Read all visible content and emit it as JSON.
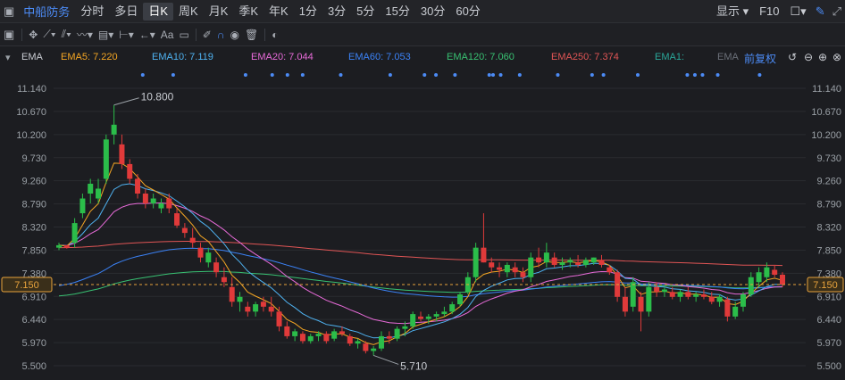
{
  "top": {
    "stock_name": "中船防务",
    "periods": [
      "分时",
      "多日",
      "日K",
      "周K",
      "月K",
      "季K",
      "年K",
      "1分",
      "3分",
      "5分",
      "15分",
      "30分",
      "60分"
    ],
    "active_period": "日K",
    "display_label": "显示",
    "f10_label": "F10"
  },
  "tools": {
    "text_tool_label": "Aa"
  },
  "indicators": {
    "main_label": "EMA",
    "ema5": "EMA5: 7.220",
    "ema10": "EMA10: 7.119",
    "ema20": "EMA20: 7.044",
    "ema60": "EMA60: 7.053",
    "ema120": "EMA120: 7.060",
    "ema250": "EMA250: 7.374",
    "ema1": "EMA1:",
    "ema_extra": "EMA",
    "adjust_label": "前复权"
  },
  "colors": {
    "up": "#2bbd4a",
    "down": "#e03a3a",
    "ema5": "#f5a623",
    "ema10": "#4fb3f2",
    "ema20": "#e86bd9",
    "ema60": "#3b82f6",
    "ema120": "#38c172",
    "ema250": "#e05555",
    "current_price": "#e8a33c"
  },
  "chart_data": {
    "type": "candlestick",
    "y_ticks": [
      "11.140",
      "10.670",
      "10.200",
      "9.730",
      "9.260",
      "8.790",
      "8.320",
      "7.850",
      "7.380",
      "6.910",
      "6.440",
      "5.970",
      "5.500"
    ],
    "ylim": [
      5.5,
      11.14
    ],
    "current_price": "7.150",
    "high_marker": "10.800",
    "low_marker": "5.710",
    "candles": [
      [
        7.9,
        8.0,
        7.85,
        7.95
      ],
      [
        7.95,
        7.95,
        7.88,
        7.9
      ],
      [
        8.0,
        8.5,
        7.9,
        8.4
      ],
      [
        8.6,
        9.0,
        8.5,
        8.9
      ],
      [
        9.0,
        9.3,
        8.8,
        9.2
      ],
      [
        8.9,
        9.3,
        8.8,
        9.1
      ],
      [
        9.3,
        10.2,
        9.2,
        10.1
      ],
      [
        10.2,
        10.8,
        10.0,
        10.4
      ],
      [
        10.0,
        10.2,
        9.5,
        9.6
      ],
      [
        9.6,
        9.7,
        9.2,
        9.3
      ],
      [
        9.3,
        9.4,
        8.9,
        9.0
      ],
      [
        9.0,
        9.1,
        8.7,
        8.8
      ],
      [
        8.8,
        9.0,
        8.7,
        8.9
      ],
      [
        8.7,
        8.9,
        8.6,
        8.8
      ],
      [
        8.9,
        9.0,
        8.6,
        8.7
      ],
      [
        8.6,
        8.7,
        8.3,
        8.35
      ],
      [
        8.3,
        8.4,
        8.1,
        8.2
      ],
      [
        8.1,
        8.3,
        7.9,
        8.0
      ],
      [
        7.9,
        8.0,
        7.6,
        7.7
      ],
      [
        7.6,
        7.9,
        7.5,
        7.8
      ],
      [
        7.6,
        7.7,
        7.3,
        7.4
      ],
      [
        7.3,
        7.5,
        7.1,
        7.2
      ],
      [
        7.1,
        7.3,
        6.7,
        6.8
      ],
      [
        6.8,
        7.0,
        6.6,
        6.9
      ],
      [
        6.7,
        6.8,
        6.5,
        6.6
      ],
      [
        6.6,
        6.8,
        6.5,
        6.75
      ],
      [
        6.8,
        6.9,
        6.6,
        6.7
      ],
      [
        6.7,
        6.9,
        6.5,
        6.6
      ],
      [
        6.6,
        6.7,
        6.2,
        6.3
      ],
      [
        6.3,
        6.4,
        6.05,
        6.1
      ],
      [
        6.1,
        6.25,
        6.0,
        6.2
      ],
      [
        6.15,
        6.2,
        5.95,
        6.0
      ],
      [
        6.0,
        6.15,
        5.95,
        6.1
      ],
      [
        6.1,
        6.2,
        6.0,
        6.15
      ],
      [
        6.15,
        6.2,
        5.95,
        6.0
      ],
      [
        6.05,
        6.25,
        6.0,
        6.2
      ],
      [
        6.2,
        6.3,
        6.1,
        6.15
      ],
      [
        6.1,
        6.15,
        5.9,
        5.95
      ],
      [
        5.95,
        6.05,
        5.85,
        6.0
      ],
      [
        5.95,
        6.0,
        5.75,
        5.8
      ],
      [
        5.8,
        5.9,
        5.71,
        5.85
      ],
      [
        5.85,
        6.2,
        5.8,
        6.1
      ],
      [
        6.1,
        6.2,
        5.95,
        6.05
      ],
      [
        6.05,
        6.3,
        6.0,
        6.25
      ],
      [
        6.25,
        6.4,
        6.1,
        6.3
      ],
      [
        6.3,
        6.6,
        6.25,
        6.55
      ],
      [
        6.5,
        6.6,
        6.4,
        6.45
      ],
      [
        6.45,
        6.55,
        6.35,
        6.5
      ],
      [
        6.5,
        6.6,
        6.4,
        6.55
      ],
      [
        6.55,
        6.7,
        6.5,
        6.6
      ],
      [
        6.6,
        6.8,
        6.55,
        6.75
      ],
      [
        6.75,
        7.0,
        6.7,
        6.95
      ],
      [
        7.0,
        7.4,
        6.95,
        7.3
      ],
      [
        7.3,
        8.0,
        7.2,
        7.9
      ],
      [
        7.9,
        8.6,
        7.6,
        7.6
      ],
      [
        7.6,
        7.7,
        7.4,
        7.5
      ],
      [
        7.5,
        7.6,
        7.3,
        7.45
      ],
      [
        7.4,
        7.6,
        7.3,
        7.55
      ],
      [
        7.5,
        7.6,
        7.3,
        7.4
      ],
      [
        7.4,
        7.5,
        7.2,
        7.3
      ],
      [
        7.3,
        7.8,
        7.2,
        7.7
      ],
      [
        7.7,
        7.9,
        7.5,
        7.6
      ],
      [
        7.6,
        8.0,
        7.5,
        7.8
      ],
      [
        7.7,
        7.8,
        7.5,
        7.55
      ],
      [
        7.55,
        7.7,
        7.45,
        7.6
      ],
      [
        7.6,
        7.7,
        7.5,
        7.65
      ],
      [
        7.6,
        7.75,
        7.5,
        7.55
      ],
      [
        7.55,
        7.7,
        7.5,
        7.65
      ],
      [
        7.6,
        7.7,
        7.55,
        7.7
      ],
      [
        7.65,
        7.75,
        7.5,
        7.55
      ],
      [
        7.5,
        7.55,
        7.35,
        7.4
      ],
      [
        7.4,
        7.45,
        6.8,
        6.9
      ],
      [
        6.9,
        7.1,
        6.5,
        6.6
      ],
      [
        6.7,
        7.3,
        6.6,
        7.2
      ],
      [
        6.9,
        7.0,
        6.2,
        6.6
      ],
      [
        6.6,
        7.2,
        6.5,
        7.1
      ],
      [
        7.1,
        7.2,
        6.9,
        7.0
      ],
      [
        7.0,
        7.1,
        6.9,
        7.05
      ],
      [
        7.0,
        7.1,
        6.85,
        6.9
      ],
      [
        6.9,
        7.05,
        6.8,
        7.0
      ],
      [
        7.0,
        7.1,
        6.85,
        6.9
      ],
      [
        6.9,
        7.0,
        6.8,
        6.95
      ],
      [
        6.95,
        7.05,
        6.85,
        6.9
      ],
      [
        6.9,
        7.0,
        6.75,
        6.8
      ],
      [
        6.8,
        6.95,
        6.7,
        6.9
      ],
      [
        6.85,
        6.9,
        6.4,
        6.5
      ],
      [
        6.5,
        6.8,
        6.45,
        6.7
      ],
      [
        6.7,
        7.0,
        6.6,
        6.95
      ],
      [
        6.95,
        7.4,
        6.9,
        7.3
      ],
      [
        7.2,
        7.5,
        7.1,
        7.4
      ],
      [
        7.3,
        7.6,
        7.2,
        7.5
      ],
      [
        7.45,
        7.55,
        7.3,
        7.35
      ],
      [
        7.35,
        7.4,
        7.1,
        7.15
      ]
    ]
  }
}
